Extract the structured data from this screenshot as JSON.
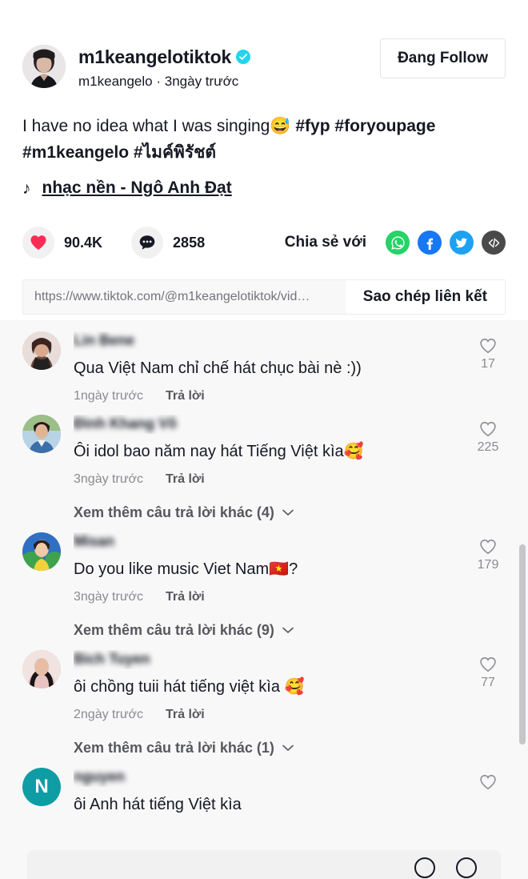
{
  "author": {
    "username": "m1keangelotiktok",
    "handle": "m1keangelo",
    "time": "3ngày trước",
    "separator": "·",
    "verified_icon": "verified-check-icon",
    "follow_label": "Đang Follow"
  },
  "caption": {
    "text_plain": "I have no idea what I was singing",
    "emoji": "😅",
    "tags": [
      "#fyp",
      "#foryoupage",
      "#m1keangelo",
      "#ไมค์พิรัชต์"
    ]
  },
  "music": {
    "note_icon": "music-note-icon",
    "title": "nhạc nền - Ngô Anh Đạt"
  },
  "stats": {
    "like_icon": "heart-filled-icon",
    "like_count": "90.4K",
    "comment_icon": "comment-bubble-icon",
    "comment_count": "2858"
  },
  "share": {
    "label": "Chia sẻ với",
    "items": [
      {
        "name": "whatsapp-icon",
        "color": "#25D366"
      },
      {
        "name": "facebook-icon",
        "color": "#1877F2"
      },
      {
        "name": "twitter-icon",
        "color": "#1DA1F2"
      },
      {
        "name": "embed-code-icon",
        "color": "#4A4A4A"
      }
    ]
  },
  "link": {
    "url": "https://www.tiktok.com/@m1keangelotiktok/vid…",
    "copy_label": "Sao chép liên kết"
  },
  "comments": [
    {
      "name": "Lin Bene",
      "text": "Qua Việt Nam chỉ chế hát chục bài nè :))",
      "time": "1ngày trước",
      "reply_label": "Trả lời",
      "like_count": "17",
      "more_replies": null
    },
    {
      "name": "Đình Khang Võ",
      "text": "Ôi idol bao năm nay hát Tiếng Việt kìa🥰",
      "time": "3ngày trước",
      "reply_label": "Trả lời",
      "like_count": "225",
      "more_replies": "Xem thêm câu trả lời khác (4)"
    },
    {
      "name": "Misan",
      "text": "Do you like music Viet Nam🇻🇳?",
      "time": "3ngày trước",
      "reply_label": "Trả lời",
      "like_count": "179",
      "more_replies": "Xem thêm câu trả lời khác (9)"
    },
    {
      "name": "Bich Tuyen",
      "text": "ôi chồng tuii hát tiếng việt kìa 🥰",
      "time": "2ngày trước",
      "reply_label": "Trả lời",
      "like_count": "77",
      "more_replies": "Xem thêm câu trả lời khác (1)"
    },
    {
      "name": "nguyen",
      "text": "ôi Anh hát tiếng Việt kìa",
      "avatar_letter": "N",
      "like_count": "",
      "more_replies": null
    }
  ],
  "colors": {
    "brand_verified": "#20D5EC",
    "like_red": "#FE2C55",
    "comment_bg": "#f8f8f8",
    "text_primary": "#161823",
    "text_secondary": "#8a8b91"
  }
}
